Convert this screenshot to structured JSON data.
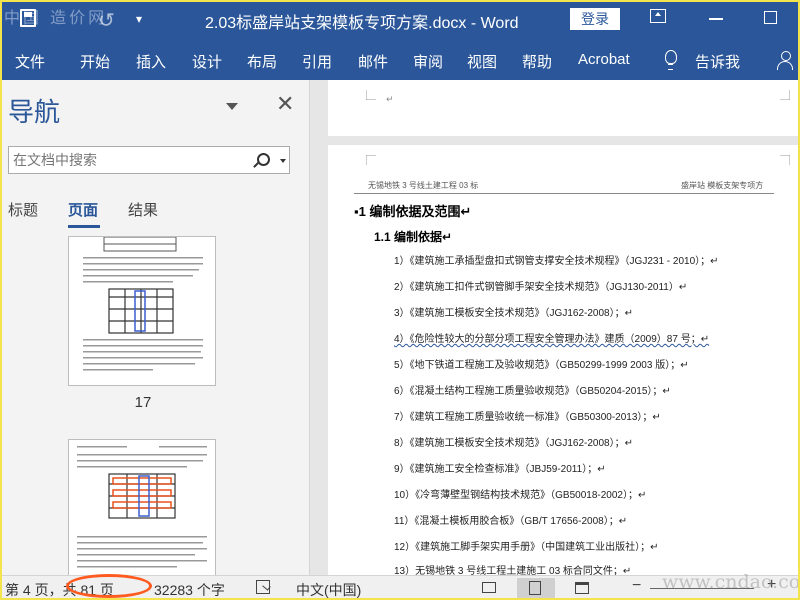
{
  "window": {
    "watermark_top": "中国 造价网",
    "title": "2.03标盛岸站支架模板专项方案.docx  -  Word",
    "login_label": "登录",
    "qat_caret": "▾"
  },
  "ribbon": {
    "tabs": [
      "文件",
      "开始",
      "插入",
      "设计",
      "布局",
      "引用",
      "邮件",
      "审阅",
      "视图",
      "帮助",
      "Acrobat"
    ],
    "tell_me": "告诉我"
  },
  "nav": {
    "title": "导航",
    "close_glyph": "✕",
    "search_placeholder": "在文档中搜索",
    "tabs": [
      "标题",
      "页面",
      "结果"
    ],
    "active_tab": "页面",
    "thumb_page_label": "17"
  },
  "document": {
    "return_mark": "↵",
    "header_left": "无锡地铁 3 号线土建工程 03 标",
    "header_right": "盛岸站 模板支架专项方",
    "heading1": "▪1  编制依据及范围↵",
    "heading2": "1.1 编制依据↵",
    "items": [
      "1）《建筑施工承插型盘扣式钢管支撑安全技术规程》（JGJ231 - 2010）；↵",
      "2）《建筑施工扣件式钢管脚手架安全技术规范》（JGJ130-2011）↵",
      "3）《建筑施工模板安全技术规范》（JGJ162-2008）；↵",
      "4）《危险性较大的分部分项工程安全管理办法》建质（2009）87 号；↵",
      "5）《地下铁道工程施工及验收规范》（GB50299-1999 2003 版）；↵",
      "6）《混凝土结构工程施工质量验收规范》（GB50204-2015）；↵",
      "7）《建筑工程施工质量验收统一标准》（GB50300-2013）；↵",
      "8）《建筑施工模板安全技术规范》（JGJ162-2008）；↵",
      "9）《建筑施工安全检查标准》（JBJ59-2011）；↵",
      "10）《冷弯薄壁型钢结构技术规范》（GB50018-2002）；↵",
      "11）《混凝土模板用胶合板》（GB/T 17656-2008）；↵",
      "12）《建筑施工脚手架实用手册》（中国建筑工业出版社）；↵",
      "13）无锡地铁 3 号线工程土建施工 03 标合同文件；↵"
    ]
  },
  "status": {
    "page": "第 4 页，共 81 页",
    "words": "32283 个字",
    "language": "中文(中国)",
    "zoom_minus": "−",
    "zoom_plus": "+",
    "watermark_bottom": "www.cndao.com"
  },
  "colors": {
    "brand": "#2b579a",
    "annotation_circle": "#ff5a1f",
    "frame": "#f2e44a"
  }
}
